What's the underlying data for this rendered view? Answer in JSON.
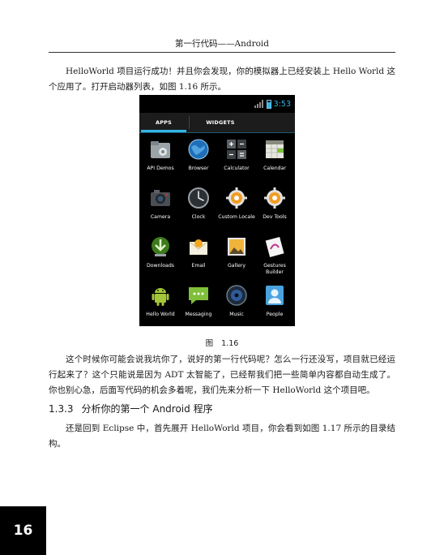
{
  "running_header": "第一行代码——Android",
  "paragraphs": {
    "p1": "HelloWorld 项目运行成功！并且你会发现，你的模拟器上已经安装上 Hello World 这个应用了。打开启动器列表，如图 1.16 所示。",
    "p2": "这个时候你可能会说我坑你了，说好的第一行代码呢？怎么一行还没写，项目就已经运行起来了？这个只能说是因为 ADT 太智能了，已经帮我们把一些简单内容都自动生成了。你也别心急，后面写代码的机会多着呢，我们先来分析一下 HelloWorld 这个项目吧。",
    "p3": "还是回到 Eclipse 中，首先展开 HelloWorld 项目，你会看到如图 1.17 所示的目录结构。"
  },
  "section": {
    "number": "1.3.3",
    "title": "分析你的第一个 Android 程序"
  },
  "figure": {
    "label": "图",
    "number": "1.16",
    "phone": {
      "time": "3:53",
      "tabs": [
        "APPS",
        "WIDGETS"
      ],
      "apps": [
        {
          "name": "API Demos",
          "icon": "folder-gear-icon"
        },
        {
          "name": "Browser",
          "icon": "globe-icon"
        },
        {
          "name": "Calculator",
          "icon": "calculator-icon"
        },
        {
          "name": "Calendar",
          "icon": "calendar-icon"
        },
        {
          "name": "Camera",
          "icon": "camera-icon"
        },
        {
          "name": "Clock",
          "icon": "clock-icon"
        },
        {
          "name": "Custom Locale",
          "icon": "gear-icon"
        },
        {
          "name": "Dev Tools",
          "icon": "gear-icon"
        },
        {
          "name": "Downloads",
          "icon": "download-icon"
        },
        {
          "name": "Email",
          "icon": "email-icon"
        },
        {
          "name": "Gallery",
          "icon": "gallery-icon"
        },
        {
          "name": "Gestures Builder",
          "icon": "gestures-icon"
        },
        {
          "name": "Hello World",
          "icon": "android-icon"
        },
        {
          "name": "Messaging",
          "icon": "messaging-icon"
        },
        {
          "name": "Music",
          "icon": "music-icon"
        },
        {
          "name": "People",
          "icon": "people-icon"
        }
      ]
    }
  },
  "page_number": "16"
}
